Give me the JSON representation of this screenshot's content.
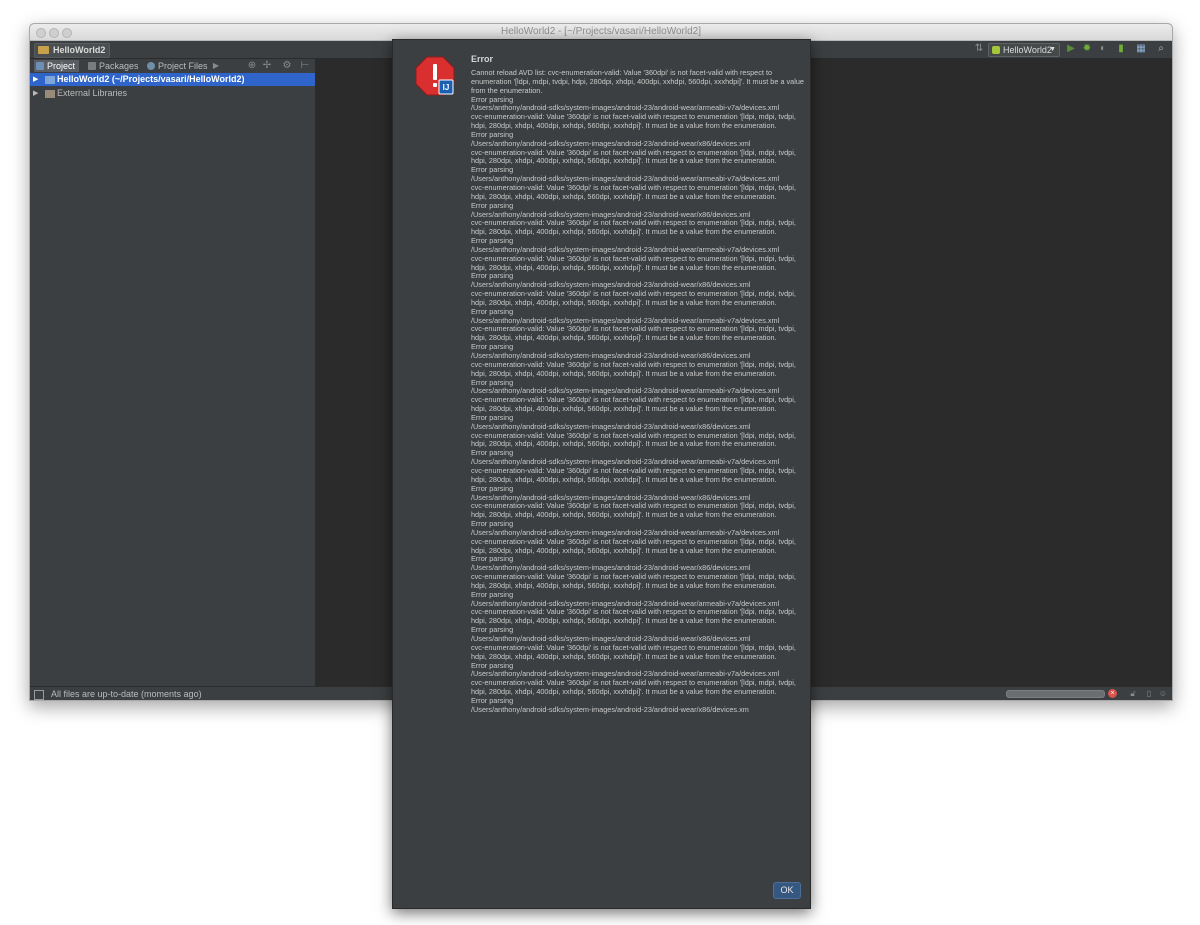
{
  "window": {
    "title": "HelloWorld2 - [~/Projects/vasari/HelloWorld2]",
    "breadcrumb": "HelloWorld2",
    "run_config": "HelloWorld2"
  },
  "project_panel": {
    "tabs": [
      {
        "label": "Project",
        "active": true
      },
      {
        "label": "Packages",
        "active": false
      },
      {
        "label": "Project Files",
        "active": false
      }
    ],
    "tree": [
      {
        "label": "HelloWorld2 (~/Projects/vasari/HelloWorld2)",
        "selected": true
      },
      {
        "label": "External Libraries",
        "selected": false
      }
    ]
  },
  "status_bar": {
    "message": "All files are up-to-date (moments ago)"
  },
  "dialog": {
    "title": "Error",
    "intro": "Cannot reload AVD list: cvc-enumeration-valid: Value '360dpi' is not facet-valid with respect to enumeration '[ldpi, mdpi, tvdpi, hdpi, 280dpi, xhdpi, 400dpi, xxhdpi, 560dpi, xxxhdpi]'. It must be a value from the enumeration.",
    "error_heading": "Error parsing",
    "error_body": "cvc-enumeration-valid: Value '360dpi' is not facet-valid with respect to enumeration '[ldpi, mdpi, tvdpi, hdpi, 280dpi, xhdpi, 400dpi, xxhdpi, 560dpi, xxxhdpi]'. It must be a value from the enumeration.",
    "paths": [
      "/Users/anthony/android-sdks/system-images/android-23/android-wear/armeabi-v7a/devices.xml",
      "/Users/anthony/android-sdks/system-images/android-23/android-wear/x86/devices.xml",
      "/Users/anthony/android-sdks/system-images/android-23/android-wear/armeabi-v7a/devices.xml",
      "/Users/anthony/android-sdks/system-images/android-23/android-wear/x86/devices.xml",
      "/Users/anthony/android-sdks/system-images/android-23/android-wear/armeabi-v7a/devices.xml",
      "/Users/anthony/android-sdks/system-images/android-23/android-wear/x86/devices.xml",
      "/Users/anthony/android-sdks/system-images/android-23/android-wear/armeabi-v7a/devices.xml",
      "/Users/anthony/android-sdks/system-images/android-23/android-wear/x86/devices.xml",
      "/Users/anthony/android-sdks/system-images/android-23/android-wear/armeabi-v7a/devices.xml",
      "/Users/anthony/android-sdks/system-images/android-23/android-wear/x86/devices.xml",
      "/Users/anthony/android-sdks/system-images/android-23/android-wear/armeabi-v7a/devices.xml",
      "/Users/anthony/android-sdks/system-images/android-23/android-wear/x86/devices.xml",
      "/Users/anthony/android-sdks/system-images/android-23/android-wear/armeabi-v7a/devices.xml",
      "/Users/anthony/android-sdks/system-images/android-23/android-wear/x86/devices.xml",
      "/Users/anthony/android-sdks/system-images/android-23/android-wear/armeabi-v7a/devices.xml",
      "/Users/anthony/android-sdks/system-images/android-23/android-wear/x86/devices.xml",
      "/Users/anthony/android-sdks/system-images/android-23/android-wear/armeabi-v7a/devices.xml"
    ],
    "last_heading": "Error parsing",
    "last_path": "/Users/anthony/android-sdks/system-images/android-23/android-wear/x86/devices.xm",
    "ok_label": "OK"
  },
  "colors": {
    "accent_selection": "#2f65ca",
    "error_icon": "#d9302f",
    "ok_button": "#365880"
  }
}
